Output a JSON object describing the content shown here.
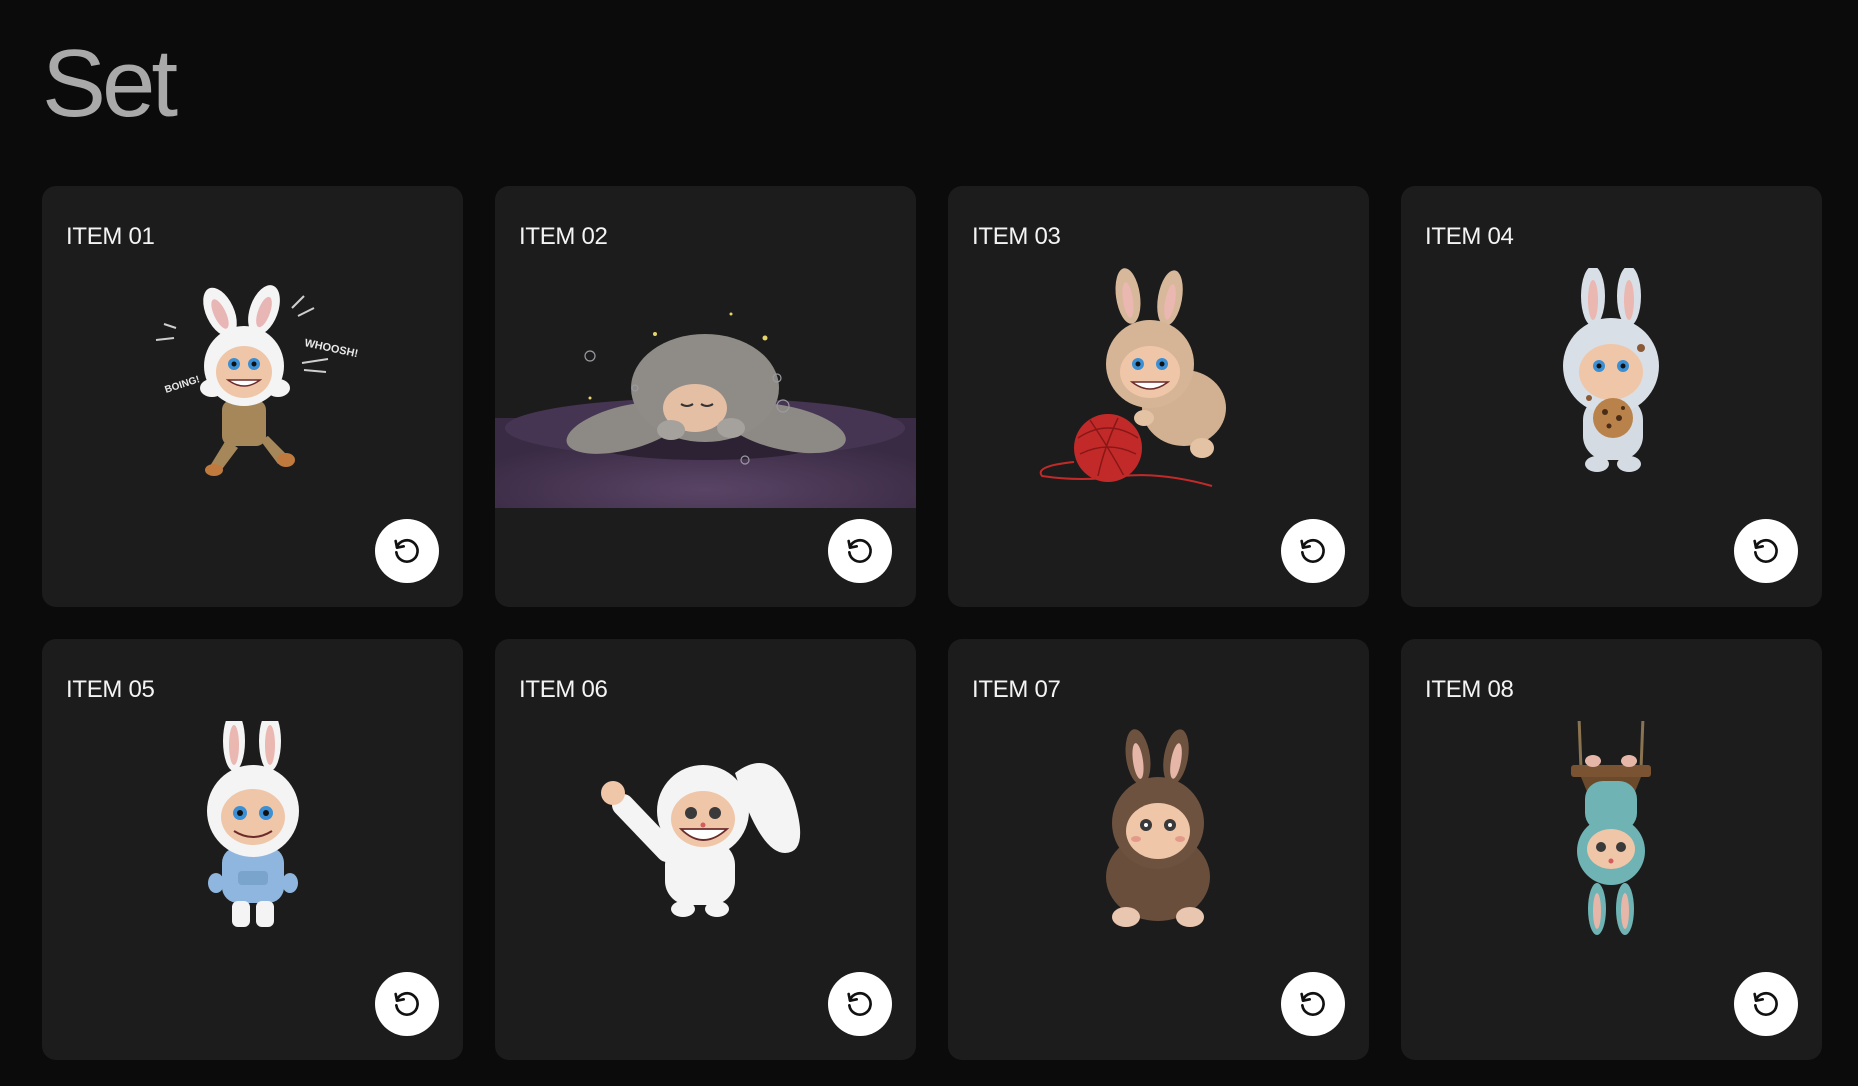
{
  "page": {
    "title": "Set"
  },
  "items": [
    {
      "label": "ITEM 01",
      "icon": "rotate-ccw-icon",
      "art": "bunny-jumping-overalls"
    },
    {
      "label": "ITEM 02",
      "icon": "rotate-ccw-icon",
      "art": "bunny-sleeping"
    },
    {
      "label": "ITEM 03",
      "icon": "rotate-ccw-icon",
      "art": "bunny-yarn-ball"
    },
    {
      "label": "ITEM 04",
      "icon": "rotate-ccw-icon",
      "art": "bunny-cookie"
    },
    {
      "label": "ITEM 05",
      "icon": "rotate-ccw-icon",
      "art": "bunny-blue-hoodie"
    },
    {
      "label": "ITEM 06",
      "icon": "rotate-ccw-icon",
      "art": "bunny-waving"
    },
    {
      "label": "ITEM 07",
      "icon": "rotate-ccw-icon",
      "art": "bunny-brown-sitting"
    },
    {
      "label": "ITEM 08",
      "icon": "rotate-ccw-icon",
      "art": "bunny-swing"
    }
  ],
  "art_text": {
    "item01_whoosh": "WHOOSH!",
    "item01_boing": "BOING!"
  },
  "colors": {
    "background": "#0b0b0b",
    "card": "#1c1c1c",
    "title": "#a9a9a9",
    "label": "#f4f4f4",
    "button": "#ffffff"
  }
}
